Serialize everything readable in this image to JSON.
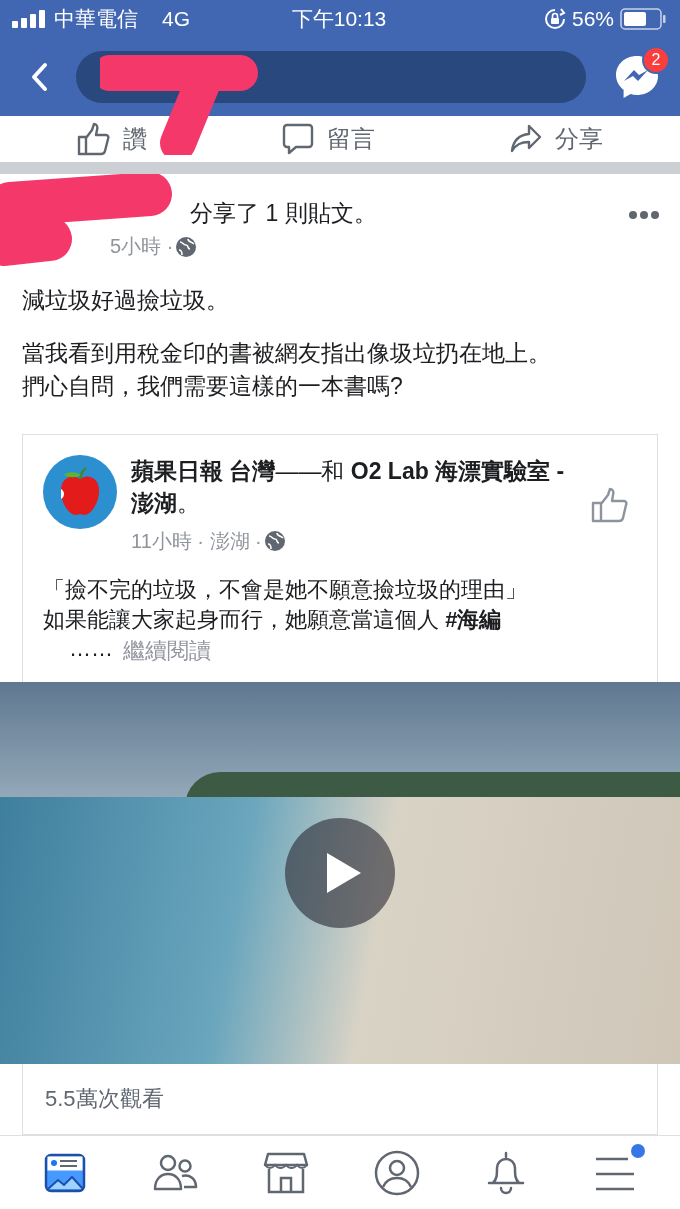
{
  "status_bar": {
    "carrier": "中華電信",
    "network": "4G",
    "time": "下午10:13",
    "battery": "56%"
  },
  "header": {
    "messenger_badge": "2"
  },
  "actions": [
    {
      "kind": "like",
      "label": "讚"
    },
    {
      "kind": "comment",
      "label": "留言"
    },
    {
      "kind": "share",
      "label": "分享"
    }
  ],
  "post": {
    "headline": "分享了 1 則貼文。",
    "time": "5小時 · ",
    "text": [
      [
        "減垃圾好過撿垃圾。"
      ],
      [
        "當我看到用稅金印的書被網友指出像圾垃扔在地上。",
        "捫心自問，我們需要這樣的一本書嗎?"
      ]
    ],
    "shared": {
      "title": "**蘋果日報 台灣**——和 **O2 Lab 海漂實驗室 - 澎湖**。",
      "meta": "11小時 · 澎湖 · ",
      "text": [
        "「撿不完的垃圾，不會是她不願意撿垃圾的理由」",
        "如果能讓大家起身而行，她願意當這個人  **#海編**"
      ],
      "more_prefix": "……",
      "more": "繼續閱讀"
    },
    "views": "5.5萬次觀看"
  },
  "nav": [
    {
      "kind": "feed",
      "selected": true,
      "badge": false
    },
    {
      "kind": "friends",
      "selected": false,
      "badge": false
    },
    {
      "kind": "marketplace",
      "selected": false,
      "badge": false
    },
    {
      "kind": "profile",
      "selected": false,
      "badge": false
    },
    {
      "kind": "notifications",
      "selected": false,
      "badge": false
    },
    {
      "kind": "menu",
      "selected": false,
      "badge": true
    }
  ]
}
